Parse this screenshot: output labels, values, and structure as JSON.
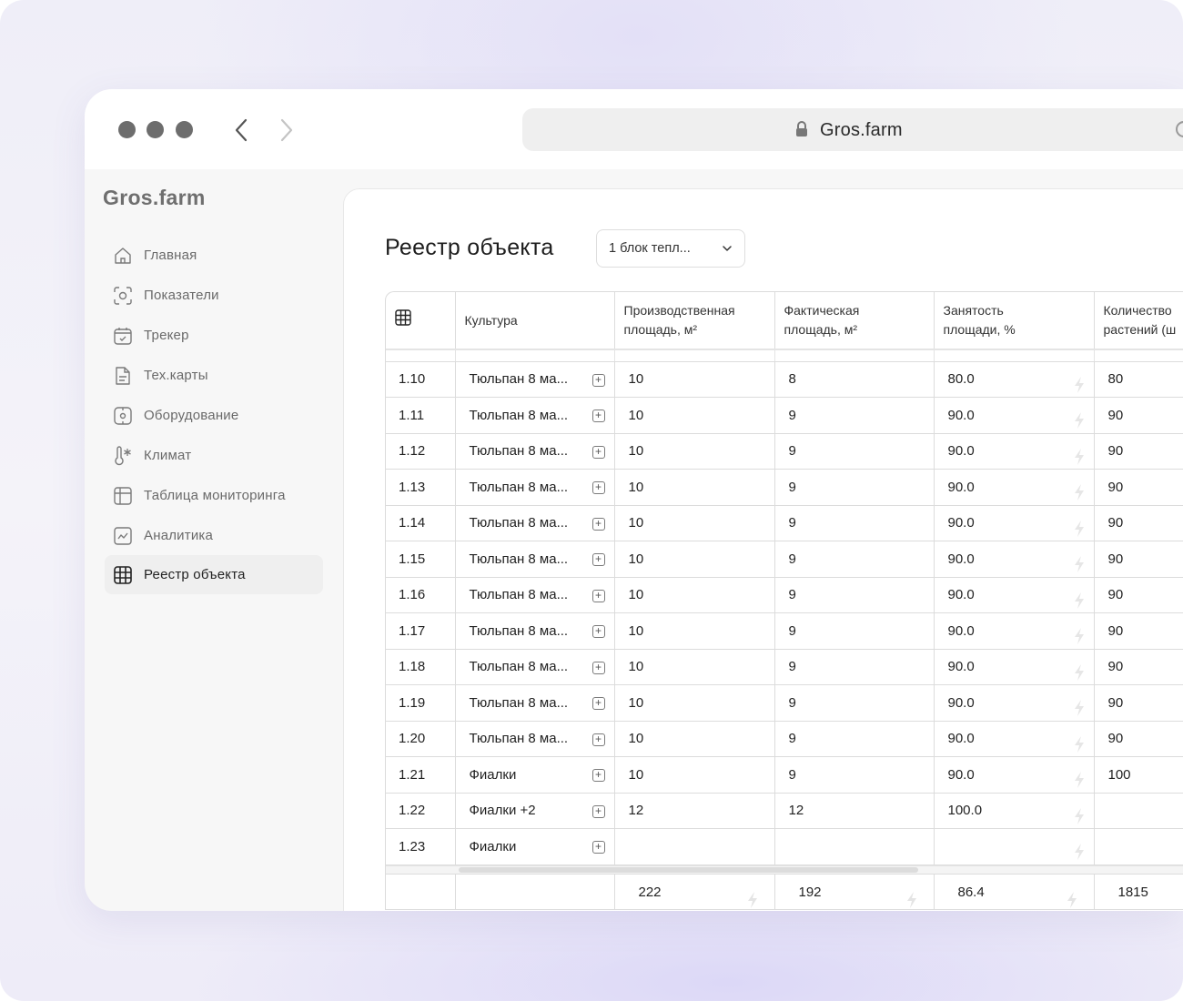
{
  "browser": {
    "url": "Gros.farm"
  },
  "sidebar": {
    "logo": "Gros.farm",
    "items": [
      {
        "label": "Главная",
        "icon": "home-icon"
      },
      {
        "label": "Показатели",
        "icon": "metrics-icon"
      },
      {
        "label": "Трекер",
        "icon": "calendar-icon"
      },
      {
        "label": "Тех.карты",
        "icon": "document-icon"
      },
      {
        "label": "Оборудование",
        "icon": "equipment-icon"
      },
      {
        "label": "Климат",
        "icon": "thermometer-icon"
      },
      {
        "label": "Таблица мониторинга",
        "icon": "table-icon"
      },
      {
        "label": "Аналитика",
        "icon": "chart-icon"
      },
      {
        "label": "Реестр объекта",
        "icon": "grid-icon",
        "active": true
      }
    ]
  },
  "main": {
    "title": "Реестр объекта",
    "block_select": {
      "value": "1 блок тепл..."
    },
    "table": {
      "columns": [
        {
          "key": "grid",
          "label": ""
        },
        {
          "key": "crop",
          "label": "Культура"
        },
        {
          "key": "prod_area",
          "label_line1": "Производственная",
          "label_line2": "площадь, м²"
        },
        {
          "key": "fact_area",
          "label_line1": "Фактическая",
          "label_line2": "площадь, м²"
        },
        {
          "key": "occupancy",
          "label_line1": "Занятость",
          "label_line2": "площади, %"
        },
        {
          "key": "plants",
          "label_line1": "Количество",
          "label_line2": "растений (ш"
        }
      ],
      "rows": [
        {
          "id": "1.10",
          "crop": "Тюльпан 8 ма...",
          "prod_area": "10",
          "fact_area": "8",
          "occupancy": "80.0",
          "plants": "80"
        },
        {
          "id": "1.11",
          "crop": "Тюльпан 8 ма...",
          "prod_area": "10",
          "fact_area": "9",
          "occupancy": "90.0",
          "plants": "90"
        },
        {
          "id": "1.12",
          "crop": "Тюльпан 8 ма...",
          "prod_area": "10",
          "fact_area": "9",
          "occupancy": "90.0",
          "plants": "90"
        },
        {
          "id": "1.13",
          "crop": "Тюльпан 8 ма...",
          "prod_area": "10",
          "fact_area": "9",
          "occupancy": "90.0",
          "plants": "90"
        },
        {
          "id": "1.14",
          "crop": "Тюльпан 8 ма...",
          "prod_area": "10",
          "fact_area": "9",
          "occupancy": "90.0",
          "plants": "90"
        },
        {
          "id": "1.15",
          "crop": "Тюльпан 8 ма...",
          "prod_area": "10",
          "fact_area": "9",
          "occupancy": "90.0",
          "plants": "90"
        },
        {
          "id": "1.16",
          "crop": "Тюльпан 8 ма...",
          "prod_area": "10",
          "fact_area": "9",
          "occupancy": "90.0",
          "plants": "90"
        },
        {
          "id": "1.17",
          "crop": "Тюльпан 8 ма...",
          "prod_area": "10",
          "fact_area": "9",
          "occupancy": "90.0",
          "plants": "90"
        },
        {
          "id": "1.18",
          "crop": "Тюльпан 8 ма...",
          "prod_area": "10",
          "fact_area": "9",
          "occupancy": "90.0",
          "plants": "90"
        },
        {
          "id": "1.19",
          "crop": "Тюльпан 8 ма...",
          "prod_area": "10",
          "fact_area": "9",
          "occupancy": "90.0",
          "plants": "90"
        },
        {
          "id": "1.20",
          "crop": "Тюльпан 8 ма...",
          "prod_area": "10",
          "fact_area": "9",
          "occupancy": "90.0",
          "plants": "90"
        },
        {
          "id": "1.21",
          "crop": "Фиалки",
          "prod_area": "10",
          "fact_area": "9",
          "occupancy": "90.0",
          "plants": "100"
        },
        {
          "id": "1.22",
          "crop": "Фиалки +2",
          "prod_area": "12",
          "fact_area": "12",
          "occupancy": "100.0",
          "plants": ""
        },
        {
          "id": "1.23",
          "crop": "Фиалки",
          "prod_area": "",
          "fact_area": "",
          "occupancy": "",
          "plants": ""
        }
      ],
      "totals": {
        "prod_area": "222",
        "fact_area": "192",
        "occupancy": "86.4",
        "plants": "1815"
      }
    }
  },
  "colors": {
    "accent_bolt": "#e6e6e6",
    "active_menu_bg": "#efefef"
  }
}
